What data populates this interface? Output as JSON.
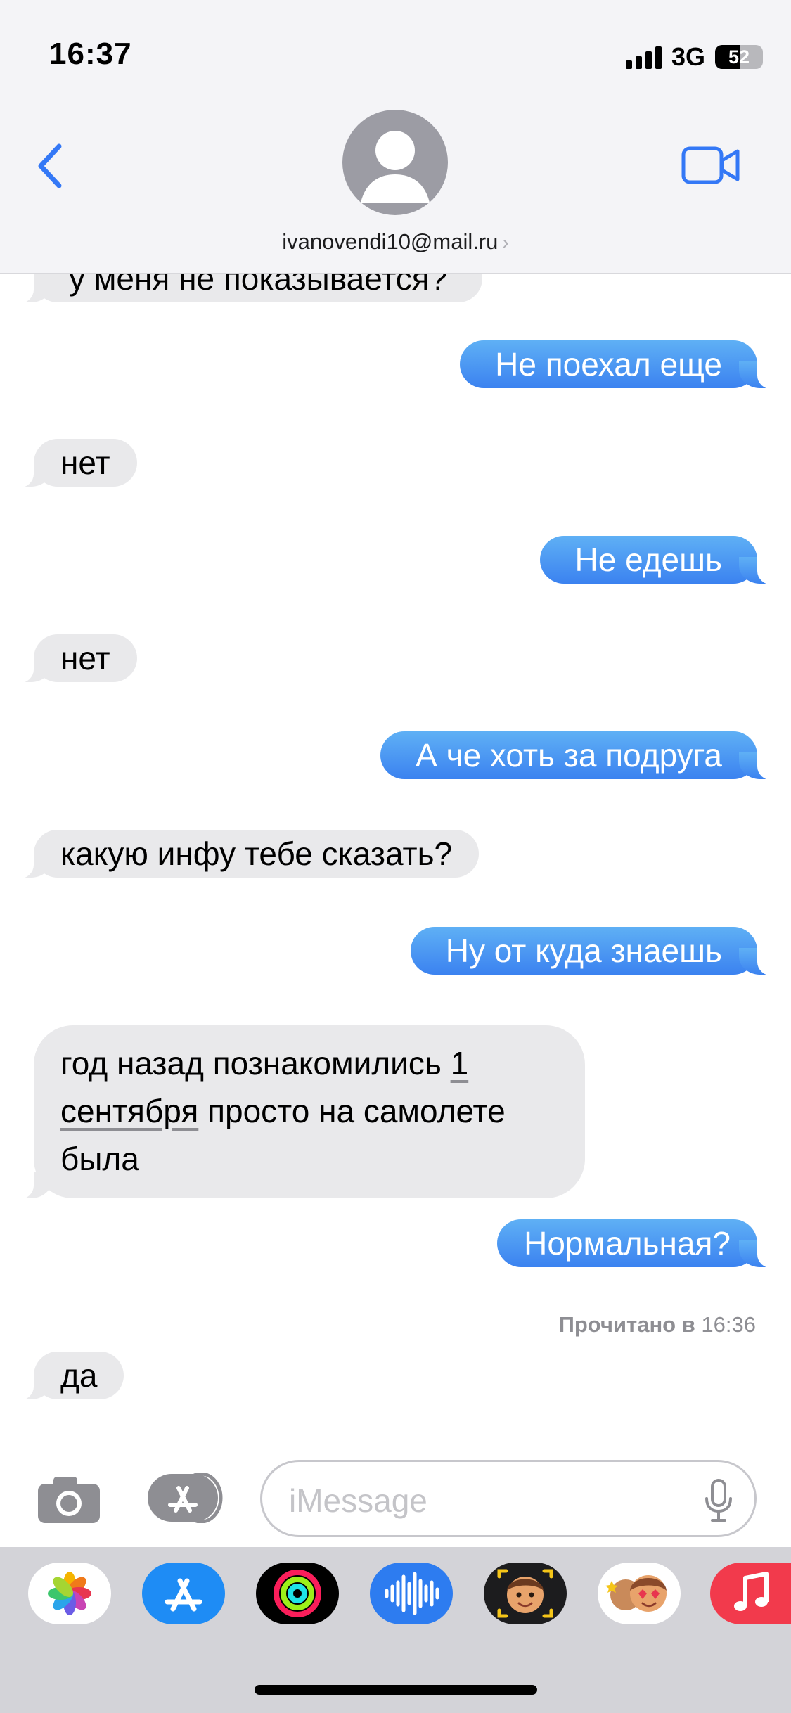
{
  "status_bar": {
    "time": "16:37",
    "network": "3G",
    "battery": "52"
  },
  "header": {
    "contact": "ivanovendi10@mail.ru",
    "chevron": "›"
  },
  "messages": [
    {
      "dir": "in",
      "text": "у меня не показывается?"
    },
    {
      "dir": "out",
      "text": "Не поехал еще"
    },
    {
      "dir": "in",
      "text": "нет"
    },
    {
      "dir": "out",
      "text": "Не едешь"
    },
    {
      "dir": "in",
      "text": "нет"
    },
    {
      "dir": "out",
      "text": "А че хоть за подруга"
    },
    {
      "dir": "in",
      "text": "какую инфу тебе сказать?"
    },
    {
      "dir": "out",
      "text": "Ну от куда знаешь"
    },
    {
      "dir": "in",
      "text_before": "год назад познакомились ",
      "link": "1 сентября",
      "text_after": " просто на самолете была"
    },
    {
      "dir": "out",
      "text": "Нормальная?"
    },
    {
      "dir": "in",
      "text": "да"
    }
  ],
  "read_receipt": {
    "label": "Прочитано в",
    "time": "16:36"
  },
  "input": {
    "placeholder": "iMessage"
  },
  "drawer_apps": [
    {
      "icon": "photos-icon"
    },
    {
      "icon": "app-store-icon"
    },
    {
      "icon": "activity-icon"
    },
    {
      "icon": "audio-message-icon"
    },
    {
      "icon": "memoji-icon"
    },
    {
      "icon": "animoji-stickers-icon"
    },
    {
      "icon": "music-icon"
    }
  ],
  "colors": {
    "accent": "#3478f6",
    "bubble_out_top": "#5fb0f5",
    "bubble_out_bottom": "#3b82f0",
    "bubble_in": "#e9e9eb"
  }
}
